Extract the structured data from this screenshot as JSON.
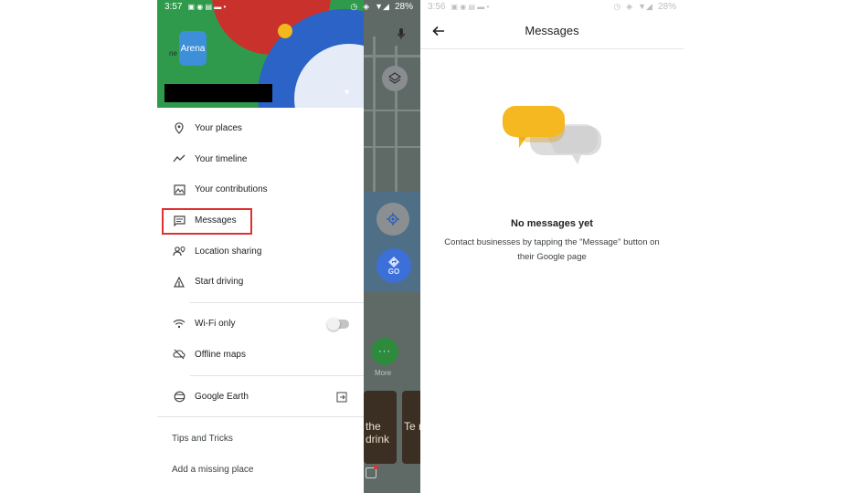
{
  "left_phone": {
    "status_bar": {
      "time": "3:57",
      "battery": "28%"
    },
    "header": {
      "avatar_text": "Arena",
      "avatar_prefix": "ne",
      "chevron": "▾"
    },
    "menu_group_1": [
      {
        "label": "Your places",
        "icon": "location-pin-icon"
      },
      {
        "label": "Your timeline",
        "icon": "timeline-icon"
      },
      {
        "label": "Your contributions",
        "icon": "contributions-icon"
      },
      {
        "label": "Messages",
        "icon": "messages-icon",
        "highlighted": true
      },
      {
        "label": "Location sharing",
        "icon": "location-sharing-icon"
      },
      {
        "label": "Start driving",
        "icon": "driving-icon"
      }
    ],
    "menu_group_2": [
      {
        "label": "Wi-Fi only",
        "icon": "wifi-icon",
        "toggle": false
      },
      {
        "label": "Offline maps",
        "icon": "offline-maps-icon"
      }
    ],
    "menu_group_3": [
      {
        "label": "Google Earth",
        "icon": "google-earth-icon",
        "trailing_icon": "open-external-icon"
      }
    ],
    "footer_links": [
      {
        "label": "Tips and Tricks"
      },
      {
        "label": "Add a missing place"
      }
    ],
    "map_peek": {
      "go_label": "GO",
      "more_label": "More",
      "thumb_1_text": "the drink",
      "thumb_2_text": "Te re"
    }
  },
  "right_phone": {
    "status_bar": {
      "time": "3:56",
      "battery": "28%"
    },
    "title": "Messages",
    "empty_state": {
      "title": "No messages yet",
      "body": "Contact businesses by tapping the \"Message\" button on their Google page"
    }
  },
  "colors": {
    "highlight": "#e03030",
    "bubble_yellow": "#f5b820",
    "bubble_grey": "#dcdcdc",
    "map_button_blue": "#3c6fd8",
    "map_button_green": "#2e8b3d"
  }
}
